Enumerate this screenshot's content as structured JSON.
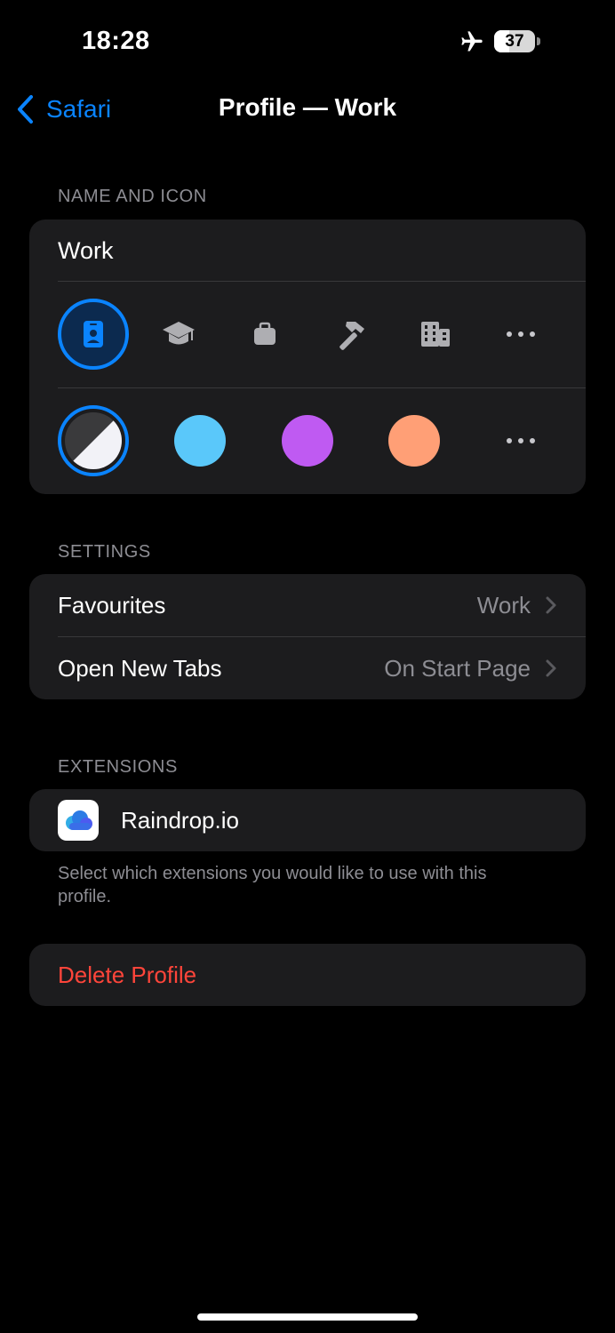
{
  "status_bar": {
    "time": "18:28",
    "battery_percent": "37",
    "battery_level": 0.37,
    "icons": [
      "airplane-icon",
      "battery-icon"
    ]
  },
  "nav": {
    "back_label": "Safari",
    "title": "Profile — Work"
  },
  "name_and_icon": {
    "header": "NAME AND ICON",
    "name_value": "Work",
    "icons": [
      "person-badge-icon",
      "graduation-cap-icon",
      "briefcase-icon",
      "hammer-icon",
      "building-icon",
      "more-icon"
    ],
    "selected_icon": "person-badge-icon",
    "colors": [
      "#3a3a3c/#f2f2f7",
      "#5ac8fa",
      "#bf5af2",
      "#ff9f76"
    ],
    "selected_color": "monochrome"
  },
  "settings": {
    "header": "SETTINGS",
    "rows": [
      {
        "label": "Favourites",
        "value": "Work"
      },
      {
        "label": "Open New Tabs",
        "value": "On Start Page"
      }
    ]
  },
  "extensions": {
    "header": "EXTENSIONS",
    "items": [
      {
        "label": "Raindrop.io",
        "icon": "raindrop-cloud-icon"
      }
    ],
    "footer": "Select which extensions you would like to use with this profile."
  },
  "delete": {
    "label": "Delete Profile"
  },
  "colors": {
    "accent": "#0a84ff",
    "destructive": "#ff453a",
    "group_bg": "#1c1c1e",
    "secondary_text": "#8d8d93"
  }
}
